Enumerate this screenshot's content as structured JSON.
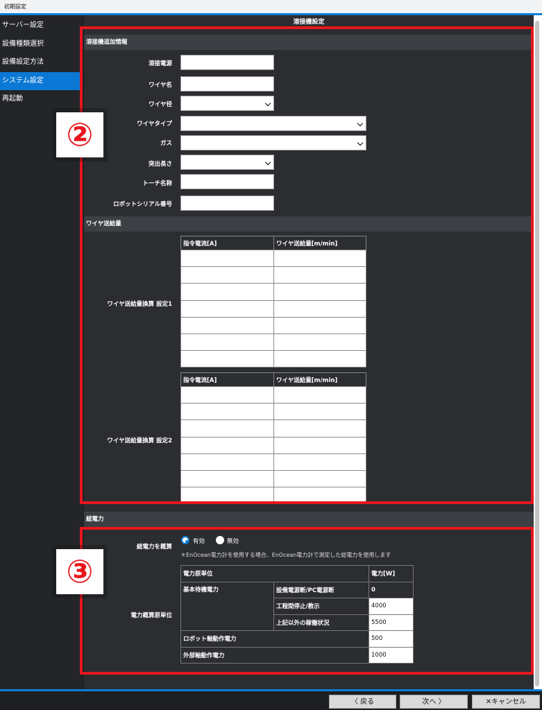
{
  "window": {
    "title": "初期設定"
  },
  "sidebar": {
    "items": [
      {
        "label": "サーバー設定"
      },
      {
        "label": "設備種類選択"
      },
      {
        "label": "設備設定方法"
      },
      {
        "label": "システム設定"
      },
      {
        "label": "再起動"
      }
    ],
    "active_index": 3
  },
  "main": {
    "title": "溶接機設定",
    "section_extra": "溶接機追加情報",
    "fields": {
      "power_source": "溶接電源",
      "wire_name": "ワイヤ名",
      "wire_diameter": "ワイヤ径",
      "wire_type": "ワイヤタイプ",
      "gas": "ガス",
      "stickout": "突出長さ",
      "torch_name": "トーチ名称",
      "robot_serial": "ロボットシリアル番号"
    },
    "section_wire": "ワイヤ送給量",
    "wire_tables": [
      {
        "label": "ワイヤ送給量換算 設定1",
        "col1": "指令電流[A]",
        "col2": "ワイヤ送給量[m/min]"
      },
      {
        "label": "ワイヤ送給量換算 設定2",
        "col1": "指令電流[A]",
        "col2": "ワイヤ送給量[m/min]"
      }
    ],
    "section_power": "総電力",
    "power_estimate": {
      "label": "総電力を概算",
      "option_on": "有効",
      "option_off": "無効",
      "note": "＊EnOcean電力計を使用する場合、EnOcean電力計で測定した総電力を使用します"
    },
    "power_table": {
      "label": "電力概算原単位",
      "h1": "電力原単位",
      "h2": "電力[W]",
      "standby": "基本待機電力",
      "r1": "設備電源断/PC電源断",
      "v1": "0",
      "r2": "工程間停止/教示",
      "v2": "4000",
      "r3": "上記以外の稼働状況",
      "v3": "5500",
      "r4": "ロボット軸動作電力",
      "v4": "500",
      "r5": "外部軸動作電力",
      "v5": "1000"
    }
  },
  "badges": {
    "b2": "②",
    "b3": "③"
  },
  "footer": {
    "back": "〈 戻る",
    "next": "次へ 〉",
    "cancel": "✕キャンセル"
  },
  "colors": {
    "accent": "#0a78d4",
    "highlight": "#e8161c"
  }
}
